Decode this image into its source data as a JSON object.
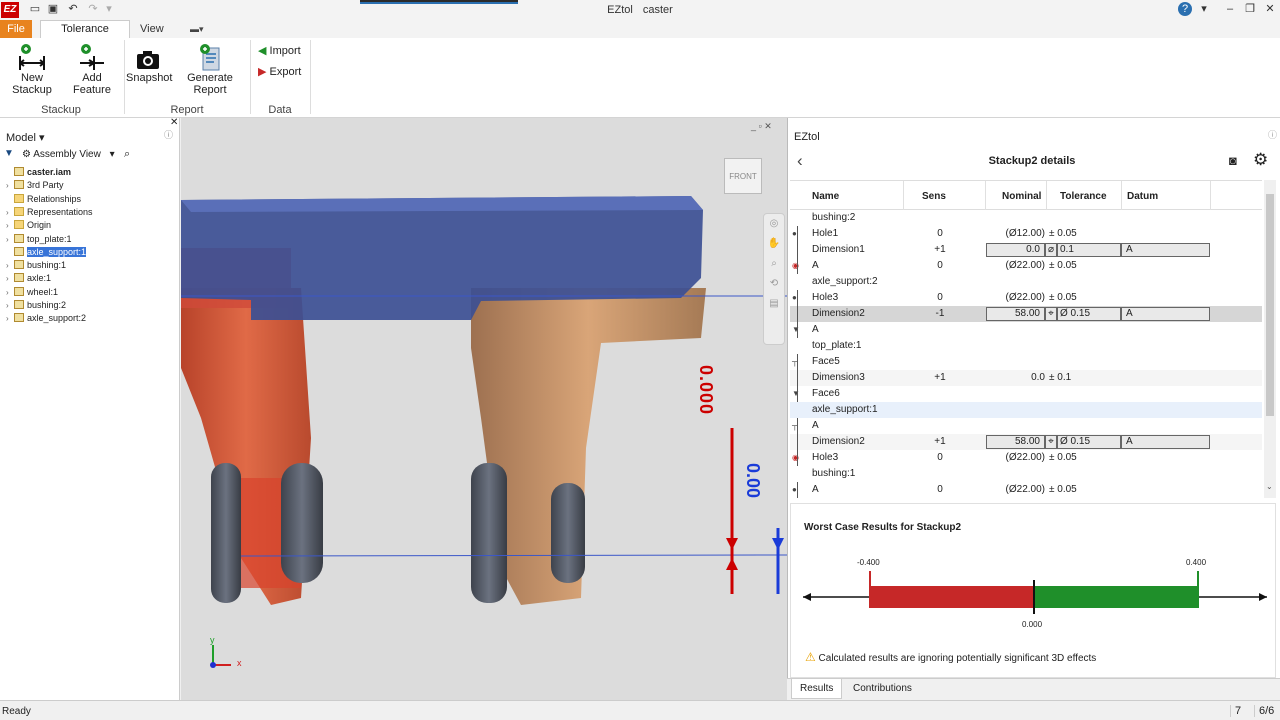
{
  "app": {
    "logo": "EZ",
    "title": "EZtol",
    "document": "caster"
  },
  "menu": {
    "file": "File",
    "tolerance_stackup": "Tolerance Stackup",
    "view": "View"
  },
  "ribbon": {
    "new_stackup": "New Stackup",
    "add_feature": "Add Feature",
    "snapshot": "Snapshot",
    "generate_report": "Generate Report",
    "import": "Import",
    "export": "Export",
    "group_stackup": "Stackup",
    "group_report": "Report",
    "group_data": "Data"
  },
  "model_panel": {
    "title": "Model",
    "view_select": "Assembly View",
    "tree": [
      {
        "label": "caster.iam",
        "icon": "assembly-icon",
        "level": 0,
        "expander": ""
      },
      {
        "label": "3rd Party",
        "icon": "part-icon",
        "level": 1,
        "expander": "›"
      },
      {
        "label": "Relationships",
        "icon": "folder-icon",
        "level": 1,
        "expander": ""
      },
      {
        "label": "Representations",
        "icon": "folder-icon",
        "level": 1,
        "expander": "›"
      },
      {
        "label": "Origin",
        "icon": "folder-icon",
        "level": 1,
        "expander": "›"
      },
      {
        "label": "top_plate:1",
        "icon": "part-icon",
        "level": 1,
        "expander": "›"
      },
      {
        "label": "axle_support:1",
        "icon": "part-icon",
        "level": 1,
        "expander": "",
        "selected": true
      },
      {
        "label": "bushing:1",
        "icon": "part-icon",
        "level": 1,
        "expander": "›"
      },
      {
        "label": "axle:1",
        "icon": "part-icon",
        "level": 1,
        "expander": "›"
      },
      {
        "label": "wheel:1",
        "icon": "part-icon",
        "level": 1,
        "expander": "›"
      },
      {
        "label": "bushing:2",
        "icon": "part-icon",
        "level": 1,
        "expander": "›"
      },
      {
        "label": "axle_support:2",
        "icon": "part-icon",
        "level": 1,
        "expander": "›"
      }
    ]
  },
  "viewport": {
    "viewcube_label": "FRONT",
    "dim_red": "0.000",
    "dim_blue": "0.00",
    "axis_x": "x",
    "axis_y": "y"
  },
  "eztol": {
    "panel_title": "EZtol",
    "stack_title": "Stackup2 details",
    "columns": {
      "name": "Name",
      "sens": "Sens",
      "nominal": "Nominal",
      "tolerance": "Tolerance",
      "datum": "Datum"
    },
    "rows": [
      {
        "name": "bushing:2",
        "sens": "",
        "nominal": "",
        "tol": "",
        "datum": "",
        "type": "header"
      },
      {
        "name": "Hole1",
        "sens": "0",
        "nominal": "(Ø12.00)",
        "tol": "± 0.05",
        "datum": "",
        "type": "plain"
      },
      {
        "name": "Dimension1",
        "sens": "+1",
        "nominal": "0.0",
        "tol": "0.1",
        "tolsym": "⌀",
        "datum": "A",
        "type": "boxed"
      },
      {
        "name": "A",
        "sens": "0",
        "nominal": "(Ø22.00)",
        "tol": "± 0.05",
        "datum": "",
        "type": "plain"
      },
      {
        "name": "axle_support:2",
        "sens": "",
        "nominal": "",
        "tol": "",
        "datum": "",
        "type": "header"
      },
      {
        "name": "Hole3",
        "sens": "0",
        "nominal": "(Ø22.00)",
        "tol": "± 0.05",
        "datum": "",
        "type": "plain"
      },
      {
        "name": "Dimension2",
        "sens": "-1",
        "nominal": "58.00",
        "tol": "Ø 0.15",
        "tolsym": "⌖",
        "datum": "A",
        "type": "boxed-sel"
      },
      {
        "name": "A",
        "sens": "",
        "nominal": "",
        "tol": "",
        "datum": "",
        "type": "plain"
      },
      {
        "name": "top_plate:1",
        "sens": "",
        "nominal": "",
        "tol": "",
        "datum": "",
        "type": "header"
      },
      {
        "name": "Face5",
        "sens": "",
        "nominal": "",
        "tol": "",
        "datum": "",
        "type": "plain"
      },
      {
        "name": "Dimension3",
        "sens": "+1",
        "nominal": "0.0",
        "tol": "± 0.1",
        "datum": "",
        "type": "even"
      },
      {
        "name": "Face6",
        "sens": "",
        "nominal": "",
        "tol": "",
        "datum": "",
        "type": "plain"
      },
      {
        "name": "axle_support:1",
        "sens": "",
        "nominal": "",
        "tol": "",
        "datum": "",
        "type": "hl"
      },
      {
        "name": "A",
        "sens": "",
        "nominal": "",
        "tol": "",
        "datum": "",
        "type": "plain"
      },
      {
        "name": "Dimension2",
        "sens": "+1",
        "nominal": "58.00",
        "tol": "Ø 0.15",
        "tolsym": "⌖",
        "datum": "A",
        "type": "boxed-even"
      },
      {
        "name": "Hole3",
        "sens": "0",
        "nominal": "(Ø22.00)",
        "tol": "± 0.05",
        "datum": "",
        "type": "plain"
      },
      {
        "name": "bushing:1",
        "sens": "",
        "nominal": "",
        "tol": "",
        "datum": "",
        "type": "header"
      },
      {
        "name": "A",
        "sens": "0",
        "nominal": "(Ø22.00)",
        "tol": "± 0.05",
        "datum": "",
        "type": "plain"
      }
    ],
    "results": {
      "title": "Worst Case Results for Stackup2",
      "min": "-0.400",
      "max": "0.400",
      "nominal": "0.000",
      "warning": "Calculated results are ignoring potentially significant 3D effects"
    },
    "tabs": {
      "results": "Results",
      "contributions": "Contributions"
    }
  },
  "status": {
    "text": "Ready",
    "page": "7",
    "pages": "6/6"
  },
  "colors": {
    "accent": "#e8831e",
    "bad": "#c62828",
    "good": "#1f8f2a",
    "selection": "#3874d8"
  }
}
